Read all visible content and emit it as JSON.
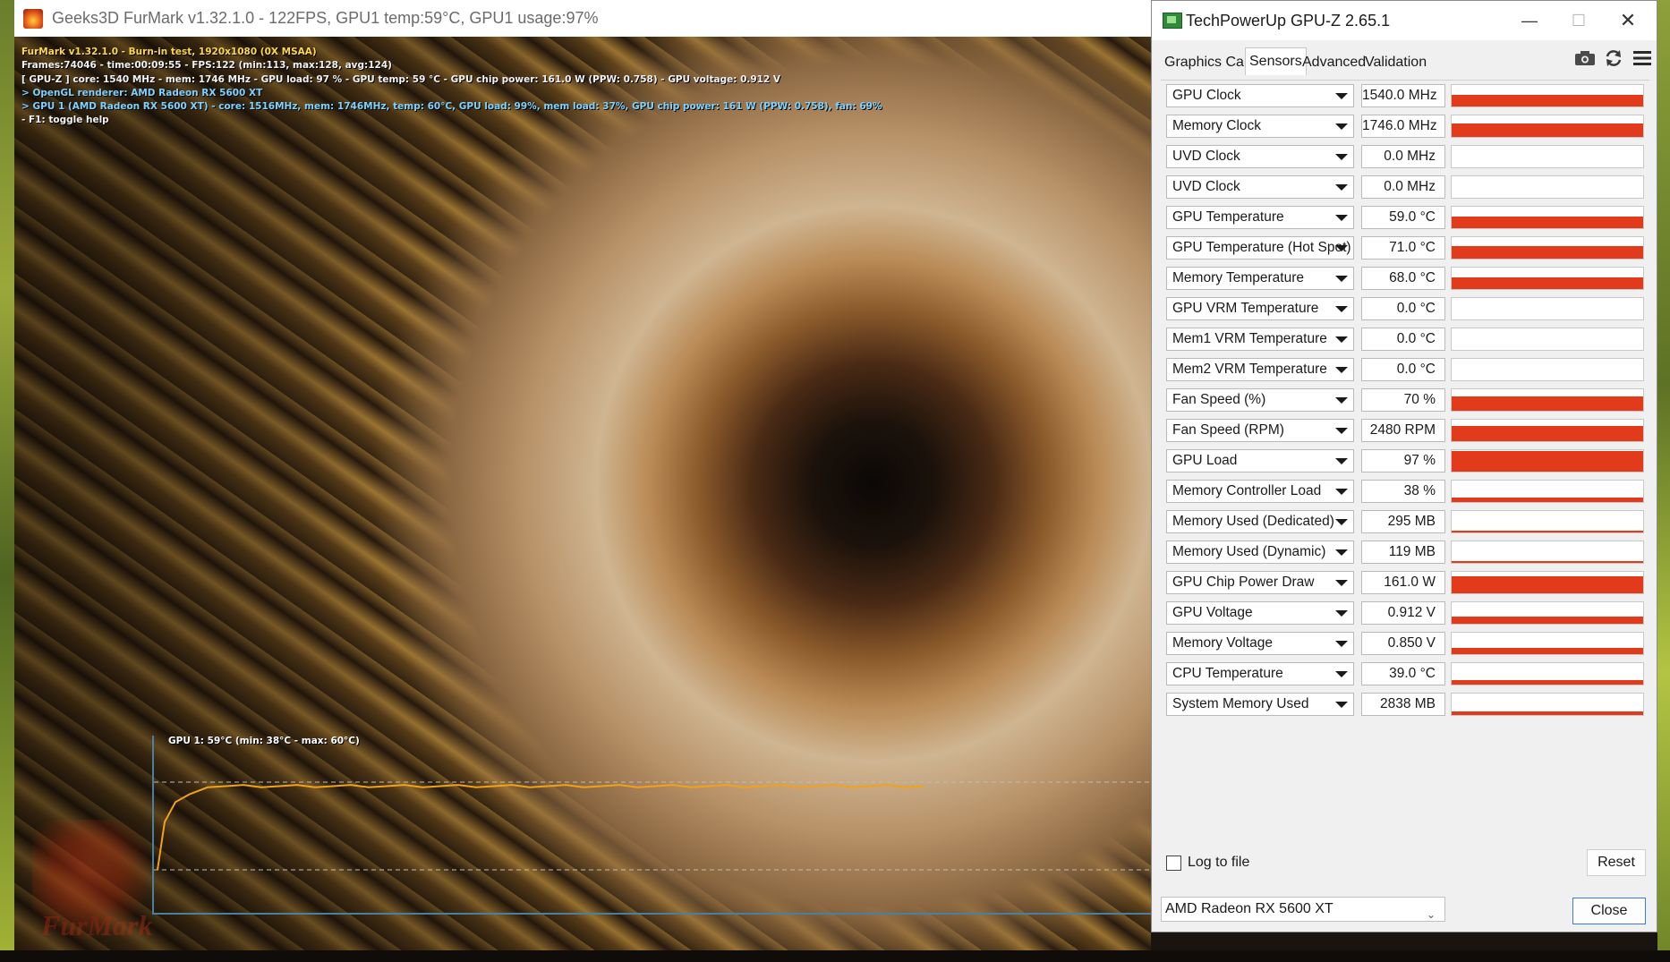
{
  "furmark": {
    "title": "Geeks3D FurMark v1.32.1.0 - 122FPS, GPU1 temp:59°C, GPU1 usage:97%",
    "osd": {
      "line1": "FurMark v1.32.1.0 - Burn-in test, 1920x1080 (0X MSAA)",
      "line2": "Frames:74046 - time:00:09:55 - FPS:122 (min:113, max:128, avg:124)",
      "line3": "[ GPU-Z ] core: 1540 MHz - mem: 1746 MHz - GPU load: 97 % - GPU temp: 59 °C - GPU chip power: 161.0 W (PPW: 0.758) - GPU voltage: 0.912 V",
      "line4": "> OpenGL renderer: AMD Radeon RX 5600 XT",
      "line5": "> GPU 1 (AMD Radeon RX 5600 XT) - core: 1516MHz, mem: 1746MHz, temp: 60°C, GPU load: 99%, mem load: 37%, GPU chip power: 161 W (PPW: 0.758), fan: 69%",
      "line6": "- F1: toggle help"
    },
    "temp_graph_label": "GPU 1: 59°C (min: 38°C - max: 60°C)",
    "logo_text": "FurMark",
    "temp_graph": {
      "min": 38,
      "max": 60,
      "current": 59
    }
  },
  "gpuz": {
    "title": "TechPowerUp GPU-Z 2.65.1",
    "window_buttons": {
      "minimize": "—",
      "maximize": "☐",
      "close": "✕"
    },
    "tabs": [
      "Graphics Card",
      "Sensors",
      "Advanced",
      "Validation"
    ],
    "active_tab": "Sensors",
    "tools": {
      "screenshot": "camera-icon",
      "refresh": "refresh-icon",
      "menu": "menu-icon"
    },
    "sensors": [
      {
        "name": "GPU Clock",
        "value": "1540.0 MHz",
        "level": 0.55
      },
      {
        "name": "Memory Clock",
        "value": "1746.0 MHz",
        "level": 0.62
      },
      {
        "name": "UVD Clock",
        "value": "0.0 MHz",
        "level": 0.0
      },
      {
        "name": "UVD Clock",
        "value": "0.0 MHz",
        "level": 0.0
      },
      {
        "name": "GPU Temperature",
        "value": "59.0 °C",
        "level": 0.55
      },
      {
        "name": "GPU Temperature (Hot Spot)",
        "value": "71.0 °C",
        "level": 0.6
      },
      {
        "name": "Memory Temperature",
        "value": "68.0 °C",
        "level": 0.55
      },
      {
        "name": "GPU VRM Temperature",
        "value": "0.0 °C",
        "level": 0.0
      },
      {
        "name": "Mem1 VRM Temperature",
        "value": "0.0 °C",
        "level": 0.0
      },
      {
        "name": "Mem2 VRM Temperature",
        "value": "0.0 °C",
        "level": 0.0
      },
      {
        "name": "Fan Speed (%)",
        "value": "70 %",
        "level": 0.65
      },
      {
        "name": "Fan Speed (RPM)",
        "value": "2480 RPM",
        "level": 0.7
      },
      {
        "name": "GPU Load",
        "value": "97 %",
        "level": 0.97
      },
      {
        "name": "Memory Controller Load",
        "value": "38 %",
        "level": 0.2
      },
      {
        "name": "Memory Used (Dedicated)",
        "value": "295 MB",
        "level": 0.06
      },
      {
        "name": "Memory Used (Dynamic)",
        "value": "119 MB",
        "level": 0.05
      },
      {
        "name": "GPU Chip Power Draw",
        "value": "161.0 W",
        "level": 0.8
      },
      {
        "name": "GPU Voltage",
        "value": "0.912 V",
        "level": 0.35
      },
      {
        "name": "Memory Voltage",
        "value": "0.850 V",
        "level": 0.3
      },
      {
        "name": "CPU Temperature",
        "value": "39.0 °C",
        "level": 0.2
      },
      {
        "name": "System Memory Used",
        "value": "2838 MB",
        "level": 0.18
      }
    ],
    "log_to_file_label": "Log to file",
    "log_to_file_checked": false,
    "reset_label": "Reset",
    "gpu_select": "AMD Radeon RX 5600 XT",
    "close_label": "Close",
    "accent_color": "#e23b1c"
  }
}
